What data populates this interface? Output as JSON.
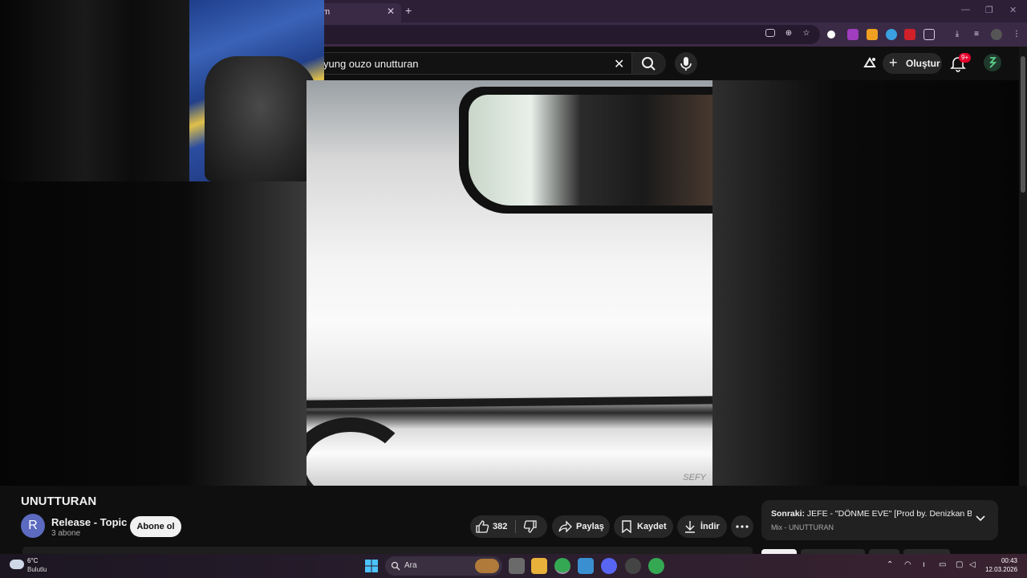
{
  "browser": {
    "tab_title": "m",
    "close_glyph": "✕",
    "new_tab_glyph": "+"
  },
  "header": {
    "search_value": "yung ouzo unutturan",
    "create_label": "Oluştur",
    "notification_count": "9+"
  },
  "video": {
    "title": "UNUTTURAN",
    "watermark": "SEFY"
  },
  "channel": {
    "avatar_letter": "R",
    "name": "Release - Topic",
    "subscribers": "3 abone",
    "subscribe_label": "Abone ol"
  },
  "actions": {
    "like_count": "382",
    "share_label": "Paylaş",
    "save_label": "Kaydet",
    "download_label": "İndir"
  },
  "up_next": {
    "prefix": "Sonraki:",
    "title": " JEFE - \"DÖNME EVE\" [Prod by. Denizkan B...",
    "subtitle": "Mix - UNUTTURAN"
  },
  "taskbar": {
    "temperature": "6°C",
    "condition": "Bulutlu",
    "search_label": "Ara",
    "time": "00:43",
    "date": "12.03.2026"
  },
  "colors": {
    "accent_badge": "#e4002b",
    "channel_avatar": "#5c6bc0",
    "browser_frame": "#3b2a46"
  }
}
